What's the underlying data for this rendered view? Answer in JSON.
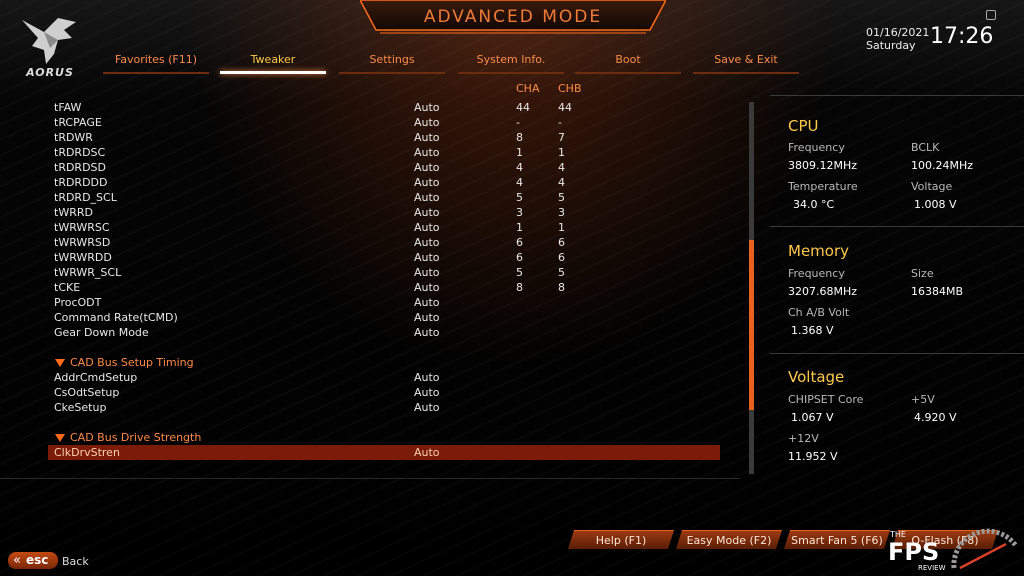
{
  "header": {
    "brand": "AORUS",
    "title": "ADVANCED MODE",
    "date": "01/16/2021",
    "day": "Saturday",
    "time": "17:26"
  },
  "tabs": [
    {
      "label": "Favorites (F11)",
      "active": false
    },
    {
      "label": "Tweaker",
      "active": true
    },
    {
      "label": "Settings",
      "active": false
    },
    {
      "label": "System Info.",
      "active": false
    },
    {
      "label": "Boot",
      "active": false
    },
    {
      "label": "Save & Exit",
      "active": false
    }
  ],
  "columns": {
    "cha": "CHA",
    "chb": "CHB"
  },
  "rows": [
    {
      "name": "tFAW",
      "value": "Auto",
      "cha": "44",
      "chb": "44"
    },
    {
      "name": "tRCPAGE",
      "value": "Auto",
      "cha": "-",
      "chb": "-"
    },
    {
      "name": "tRDWR",
      "value": "Auto",
      "cha": "8",
      "chb": "7"
    },
    {
      "name": "tRDRDSC",
      "value": "Auto",
      "cha": "1",
      "chb": "1"
    },
    {
      "name": "tRDRDSD",
      "value": "Auto",
      "cha": "4",
      "chb": "4"
    },
    {
      "name": "tRDRDDD",
      "value": "Auto",
      "cha": "4",
      "chb": "4"
    },
    {
      "name": "tRDRD_SCL",
      "value": "Auto",
      "cha": "5",
      "chb": "5"
    },
    {
      "name": "tWRRD",
      "value": "Auto",
      "cha": "3",
      "chb": "3"
    },
    {
      "name": "tWRWRSC",
      "value": "Auto",
      "cha": "1",
      "chb": "1"
    },
    {
      "name": "tWRWRSD",
      "value": "Auto",
      "cha": "6",
      "chb": "6"
    },
    {
      "name": "tWRWRDD",
      "value": "Auto",
      "cha": "6",
      "chb": "6"
    },
    {
      "name": "tWRWR_SCL",
      "value": "Auto",
      "cha": "5",
      "chb": "5"
    },
    {
      "name": "tCKE",
      "value": "Auto",
      "cha": "8",
      "chb": "8"
    },
    {
      "name": "ProcODT",
      "value": "Auto",
      "cha": "",
      "chb": ""
    },
    {
      "name": "Command Rate(tCMD)",
      "value": "Auto",
      "cha": "",
      "chb": ""
    },
    {
      "name": "Gear Down Mode",
      "value": "Auto",
      "cha": "",
      "chb": ""
    }
  ],
  "section1": {
    "title": "CAD Bus Setup Timing",
    "rows": [
      {
        "name": "AddrCmdSetup",
        "value": "Auto"
      },
      {
        "name": "CsOdtSetup",
        "value": "Auto"
      },
      {
        "name": "CkeSetup",
        "value": "Auto"
      }
    ]
  },
  "section2": {
    "title": "CAD Bus Drive Strength",
    "rows": [
      {
        "name": "ClkDrvStren",
        "value": "Auto"
      }
    ]
  },
  "scroll_position": 0.55,
  "cpu": {
    "title": "CPU",
    "freq_label": "Frequency",
    "freq": "3809.12MHz",
    "bclk_label": "BCLK",
    "bclk": "100.24MHz",
    "temp_label": "Temperature",
    "temp": "34.0 °C",
    "volt_label": "Voltage",
    "volt": "1.008 V"
  },
  "memory": {
    "title": "Memory",
    "freq_label": "Frequency",
    "freq": "3207.68MHz",
    "size_label": "Size",
    "size": "16384MB",
    "chvolt_label": "Ch A/B Volt",
    "chvolt": "1.368 V"
  },
  "voltage": {
    "title": "Voltage",
    "chipset_label": "CHIPSET Core",
    "chipset": "1.067 V",
    "p5_label": "+5V",
    "p5": "4.920 V",
    "p12_label": "+12V",
    "p12": "11.952 V"
  },
  "footer": {
    "help": "Help (F1)",
    "easy": "Easy Mode (F2)",
    "fan": "Smart Fan 5 (F6)",
    "qflash": "Q-Flash (F8)",
    "esc": "esc",
    "back": "Back"
  },
  "watermark": {
    "top": "THE",
    "main": "FPS",
    "bottom": "REVIEW"
  },
  "colors": {
    "accent": "#ff8a4a",
    "highlight": "#ffc84a",
    "selection": "#7a1c08"
  }
}
